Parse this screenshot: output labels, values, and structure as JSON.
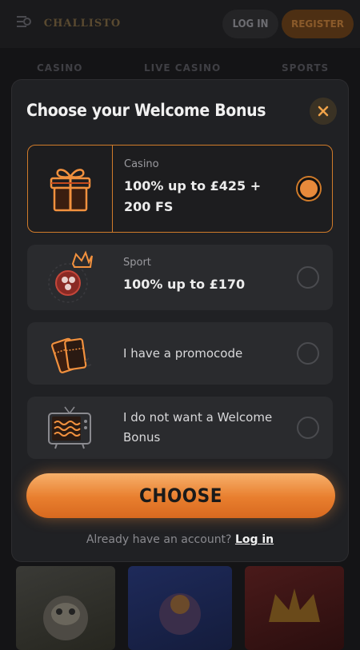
{
  "header": {
    "login_label": "LOG IN",
    "register_label": "REGISTER",
    "logo_text": "CHALLISTO"
  },
  "nav": {
    "items": [
      "CASINO",
      "LIVE CASINO",
      "SPORTS"
    ]
  },
  "modal": {
    "title": "Choose your Welcome Bonus",
    "options": [
      {
        "category": "Casino",
        "label_line1": "100% up to £425 +",
        "label_line2": "200 FS",
        "selected": true,
        "icon": "gift-icon"
      },
      {
        "category": "Sport",
        "label_line1": "100% up to £170",
        "selected": false,
        "icon": "soccer-ball-crown-icon"
      },
      {
        "label_line1": "I have a promocode",
        "selected": false,
        "icon": "tickets-icon"
      },
      {
        "label_line1": "I do not want a Welcome",
        "label_line2": "Bonus",
        "selected": false,
        "icon": "tv-icon"
      }
    ],
    "choose_label": "CHOOSE",
    "account_prompt": "Already have an account?",
    "login_link": "Log in"
  },
  "colors": {
    "accent": "#e87e2e",
    "modal_bg": "#202124",
    "option_bg": "#2a2b2e"
  }
}
